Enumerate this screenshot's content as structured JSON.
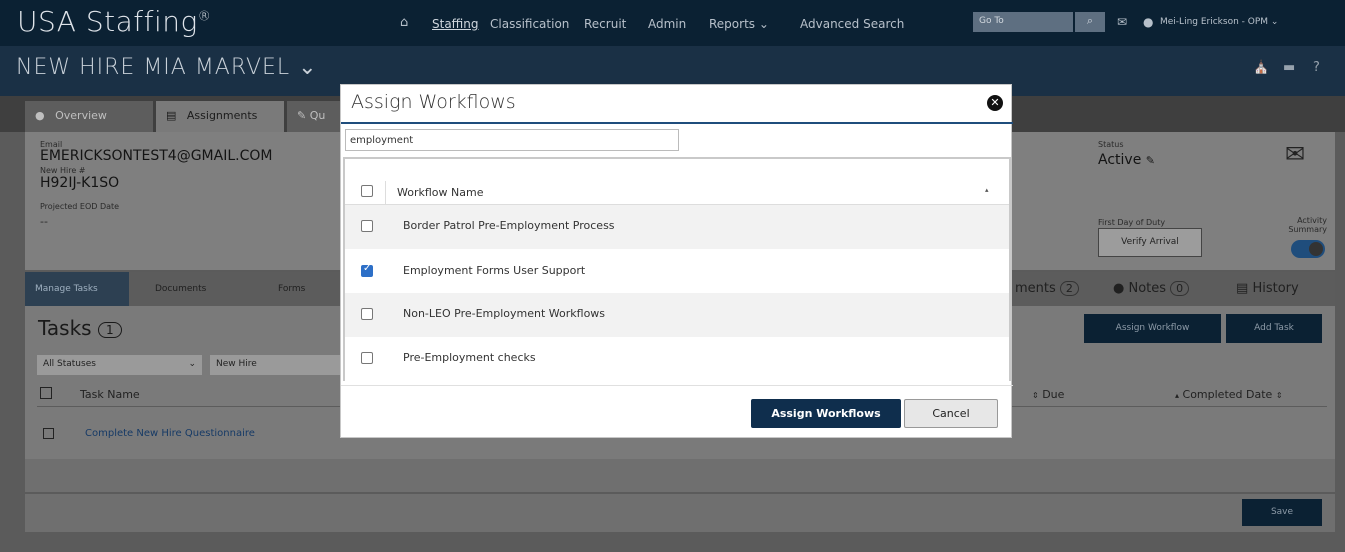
{
  "brand": {
    "name": "USA Staffing",
    "reg": "®"
  },
  "nav": {
    "items": [
      "Staffing",
      "Classification",
      "Recruit",
      "Admin",
      "Reports",
      "Advanced Search"
    ],
    "goto_placeholder": "Go To",
    "user": "Mei-Ling Erickson - OPM"
  },
  "page": {
    "title": "NEW HIRE MIA MARVEL"
  },
  "tabs": [
    "Overview",
    "Assignments",
    "Qu"
  ],
  "info": {
    "email_label": "Email",
    "email": "EMERICKSONTEST4@GMAIL.COM",
    "newhire_label": "New Hire #",
    "newhire": "H92IJ-K1SO",
    "eod_label": "Projected EOD Date",
    "eod": "--",
    "status_label": "Status",
    "status": "Active",
    "first_day_label": "First Day of Duty",
    "verify_label": "Verify Arrival",
    "activity_label": "Activity Summary"
  },
  "steps": [
    "Manage Tasks",
    "Documents",
    "Forms"
  ],
  "right_tabs": {
    "comments": "ments",
    "comments_count": "2",
    "notes": "Notes",
    "notes_count": "0",
    "history": "History"
  },
  "tasks": {
    "title": "Tasks",
    "count": "1",
    "filter_status": "All Statuses",
    "filter_type": "New Hire",
    "col_task": "Task Name",
    "col_due": "Due",
    "col_completed": "Completed Date",
    "rows": [
      "Complete New Hire Questionnaire"
    ],
    "assign_workflow": "Assign Workflow",
    "add_task": "Add Task",
    "save": "Save"
  },
  "modal": {
    "title": "Assign Workflows",
    "search_value": "employment",
    "col_header": "Workflow Name",
    "rows": [
      {
        "label": "Border Patrol Pre-Employment Process",
        "checked": false
      },
      {
        "label": "Employment Forms User Support",
        "checked": true
      },
      {
        "label": "Non-LEO Pre-Employment Workflows",
        "checked": false
      },
      {
        "label": "Pre-Employment checks",
        "checked": false
      }
    ],
    "assign_label": "Assign Workflows",
    "cancel_label": "Cancel"
  },
  "colors": {
    "nav_bg": "#0b2133",
    "accent": "#1f4d7c",
    "checkbox_checked": "#2d6fc7"
  }
}
